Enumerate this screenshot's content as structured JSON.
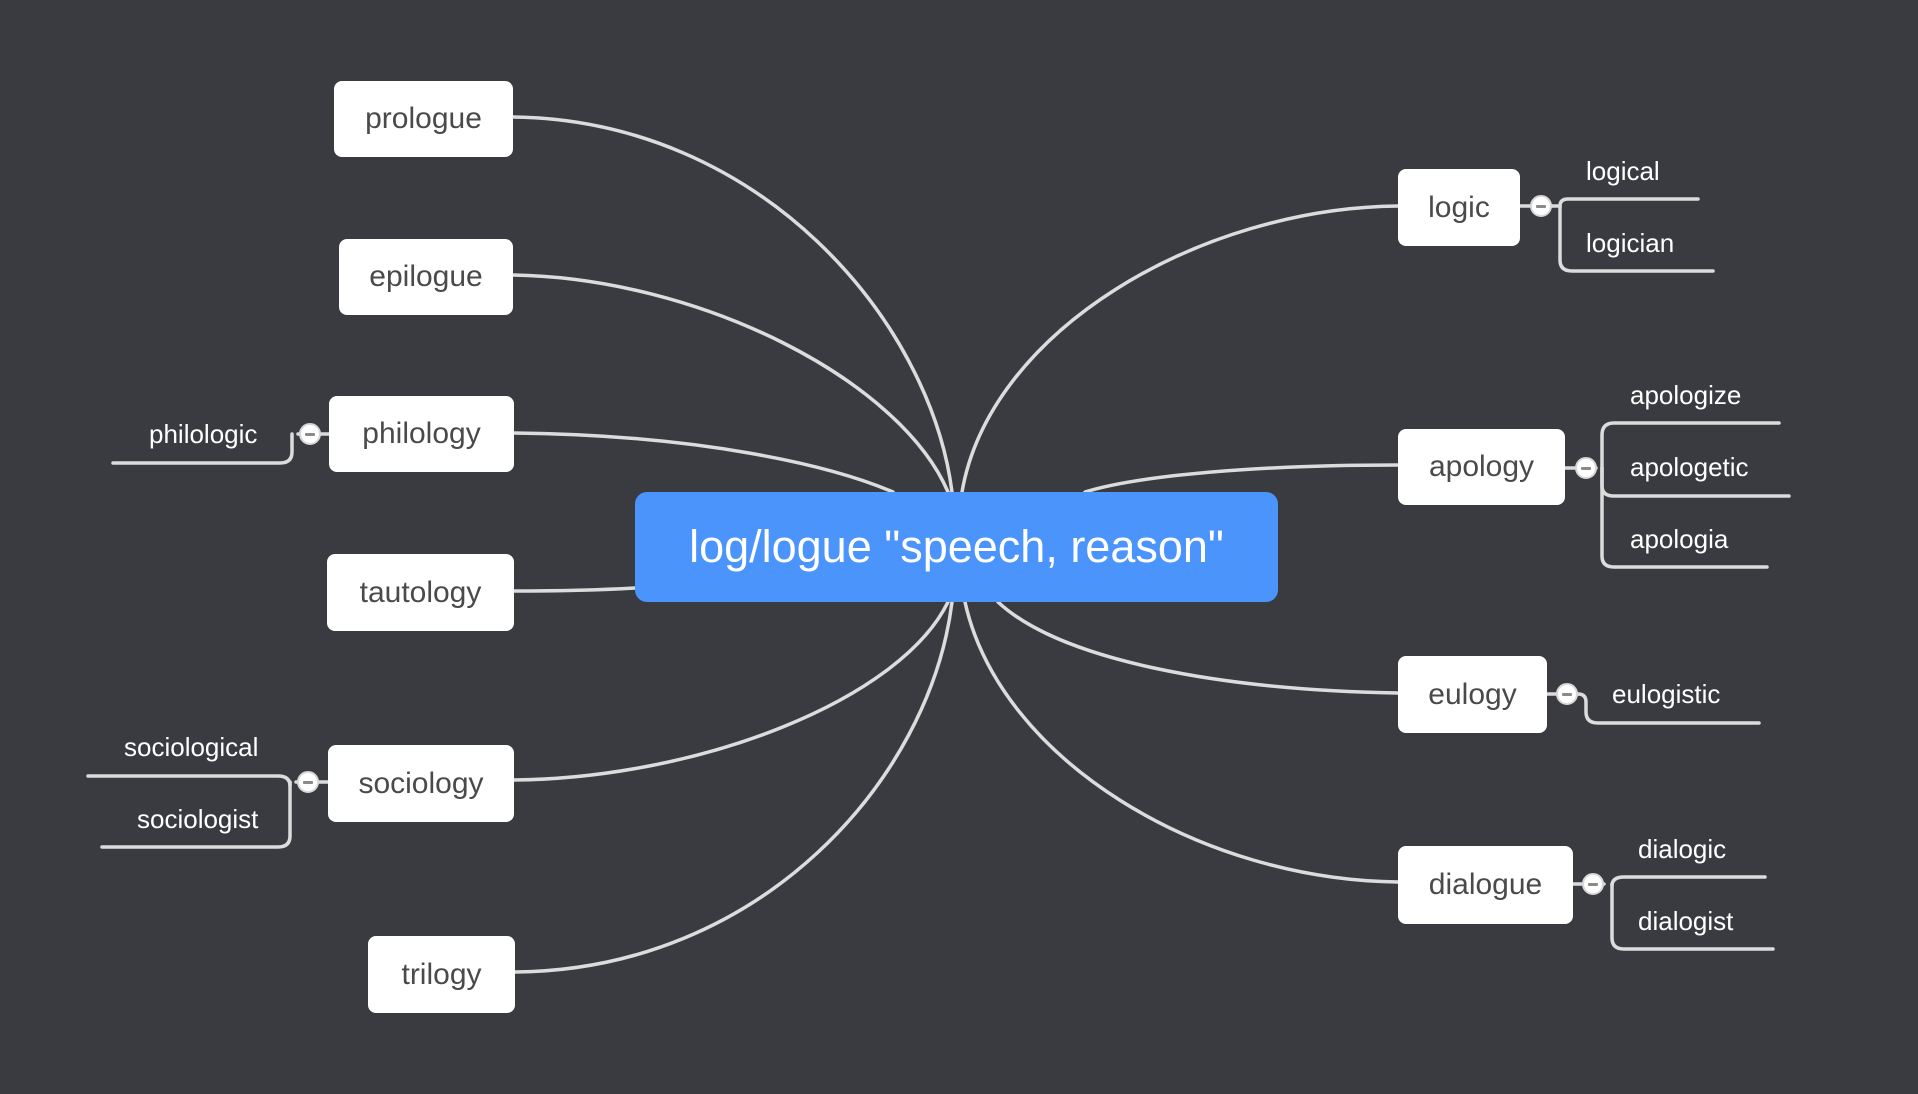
{
  "colors": {
    "background": "#393b41",
    "central_topic": "#4a94fc",
    "branch_node": "#ffffff",
    "connector": "#dcdcdc",
    "node_text": "#4a4a4a",
    "subtopic_text": "#ffffff"
  },
  "central_topic": {
    "label": "log/logue \"speech, reason\""
  },
  "left_branches": [
    {
      "label": "prologue",
      "children": []
    },
    {
      "label": "epilogue",
      "children": []
    },
    {
      "label": "philology",
      "children": [
        "philologic"
      ]
    },
    {
      "label": "tautology",
      "children": []
    },
    {
      "label": "sociology",
      "children": [
        "sociological",
        "sociologist"
      ]
    },
    {
      "label": "trilogy",
      "children": []
    }
  ],
  "right_branches": [
    {
      "label": "logic",
      "children": [
        "logical",
        "logician"
      ]
    },
    {
      "label": "apology",
      "children": [
        "apologize",
        "apologetic",
        "apologia"
      ]
    },
    {
      "label": "eulogy",
      "children": [
        "eulogistic"
      ]
    },
    {
      "label": "dialogue",
      "children": [
        "dialogic",
        "dialogist"
      ]
    }
  ],
  "icons": {
    "collapse": "minus-circle-icon"
  }
}
